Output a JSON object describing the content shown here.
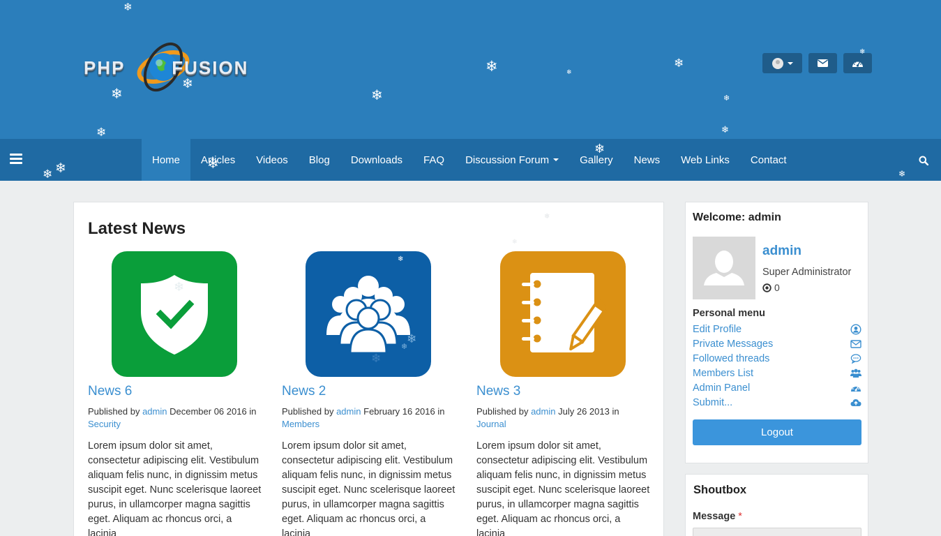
{
  "header": {
    "logo_text": "PHP FUSION",
    "buttons": [
      "user-menu",
      "messages",
      "admin-dashboard"
    ]
  },
  "nav": {
    "items": [
      {
        "label": "Home",
        "active": true
      },
      {
        "label": "Articles"
      },
      {
        "label": "Videos"
      },
      {
        "label": "Blog"
      },
      {
        "label": "Downloads"
      },
      {
        "label": "FAQ"
      },
      {
        "label": "Discussion Forum",
        "dropdown": true
      },
      {
        "label": "Gallery"
      },
      {
        "label": "News"
      },
      {
        "label": "Web Links"
      },
      {
        "label": "Contact"
      }
    ]
  },
  "main": {
    "title": "Latest News",
    "news": [
      {
        "title": "News 6",
        "published_by": "Published by",
        "author": "admin",
        "date": "December 06 2016",
        "in": "in",
        "category": "Security",
        "body": "Lorem ipsum dolor sit amet, consectetur adipiscing elit. Vestibulum aliquam felis nunc, in dignissim metus suscipit eget. Nunc scelerisque laoreet purus, in ullamcorper magna sagittis eget. Aliquam ac rhoncus orci, a lacinia",
        "color": "#0a9e3a",
        "icon": "shield-check-icon"
      },
      {
        "title": "News 2",
        "published_by": "Published by",
        "author": "admin",
        "date": "February 16 2016",
        "in": "in",
        "category": "Members",
        "body": "Lorem ipsum dolor sit amet, consectetur adipiscing elit. Vestibulum aliquam felis nunc, in dignissim metus suscipit eget. Nunc scelerisque laoreet purus, in ullamcorper magna sagittis eget. Aliquam ac rhoncus orci, a lacinia",
        "color": "#0d5fa6",
        "icon": "users-group-icon"
      },
      {
        "title": "News 3",
        "published_by": "Published by",
        "author": "admin",
        "date": "July 26 2013",
        "in": "in",
        "category": "Journal",
        "body": "Lorem ipsum dolor sit amet, consectetur adipiscing elit. Vestibulum aliquam felis nunc, in dignissim metus suscipit eget. Nunc scelerisque laoreet purus, in ullamcorper magna sagittis eget. Aliquam ac rhoncus orci, a lacinia",
        "color": "#db9114",
        "icon": "notebook-pencil-icon"
      }
    ]
  },
  "sidebar": {
    "welcome": "Welcome: admin",
    "username": "admin",
    "role": "Super Administrator",
    "points": "0",
    "personal_menu_title": "Personal menu",
    "personal_menu": [
      {
        "label": "Edit Profile",
        "icon": "user-circle-icon"
      },
      {
        "label": "Private Messages",
        "icon": "envelope-icon"
      },
      {
        "label": "Followed threads",
        "icon": "comment-icon"
      },
      {
        "label": "Members List",
        "icon": "users-icon"
      },
      {
        "label": "Admin Panel",
        "icon": "dashboard-icon"
      },
      {
        "label": "Submit...",
        "icon": "cloud-upload-icon"
      }
    ],
    "logout_label": "Logout"
  },
  "shoutbox": {
    "title": "Shoutbox",
    "message_label": "Message",
    "required_mark": "*"
  },
  "colors": {
    "header_bg": "#2b7ebb",
    "nav_bg": "#1f6aa3",
    "link": "#3b8fd0",
    "logout_bg": "#3b95dc"
  }
}
